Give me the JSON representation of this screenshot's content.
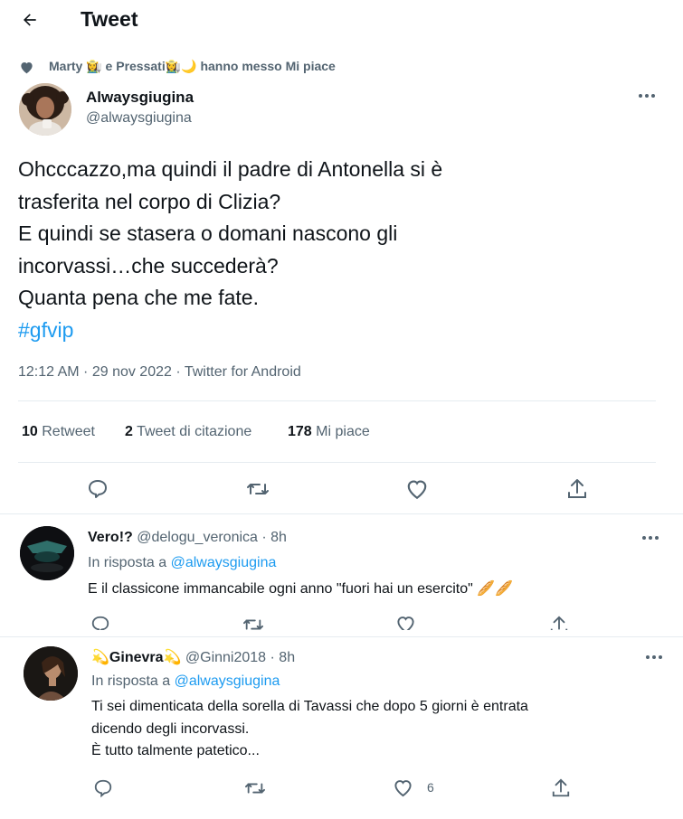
{
  "header": {
    "title": "Tweet"
  },
  "social_context": {
    "text": "Marty 👩‍🌾 e Pressati👩‍🌾🌙 hanno messo Mi piace"
  },
  "main_tweet": {
    "display_name": "Alwaysgiugina",
    "handle": "@alwaysgiugina",
    "text_lines": [
      "Ohcccazzo,ma quindi il padre di Antonella si è",
      "trasferita nel corpo di Clizia?",
      "E quindi se stasera o domani nascono gli",
      "incorvassi…che succederà?",
      "Quanta pena che me fate."
    ],
    "hashtag": "#gfvip",
    "meta": "12:12 AM · 29 nov 2022 · Twitter for Android",
    "stats": [
      {
        "count": "10",
        "label": "Retweet"
      },
      {
        "count": "2",
        "label": "Tweet di citazione"
      },
      {
        "count": "178",
        "label": "Mi piace"
      }
    ]
  },
  "replies": [
    {
      "display_name": "Vero!?",
      "handle": "@delogu_veronica",
      "time": "· 8h",
      "reply_prefix": "In risposta a",
      "reply_to": "@alwaysgiugina",
      "text_lines": [
        "E il classicone immancabile ogni anno \"fuori hai un esercito\" 🥖🥖"
      ],
      "like_count": ""
    },
    {
      "name_prefix_emoji": "💫",
      "display_name": "Ginevra",
      "name_suffix_emoji": "💫",
      "handle": "@Ginni2018",
      "time": "· 8h",
      "reply_prefix": "In risposta a",
      "reply_to": "@alwaysgiugina",
      "text_lines": [
        "Ti sei dimenticata della sorella di Tavassi che dopo 5 giorni è entrata",
        "dicendo degli incorvassi.",
        "È tutto talmente patetico..."
      ],
      "like_count": "6"
    }
  ],
  "colors": {
    "accent": "#1d9bf0",
    "muted": "#536471",
    "text": "#0f1419",
    "border": "#e6ecf0"
  }
}
